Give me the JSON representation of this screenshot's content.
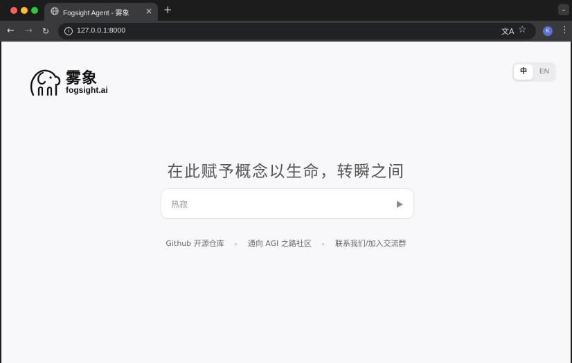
{
  "browser": {
    "tab_title": "Fogsight Agent - 雾象",
    "tab_close": "×",
    "new_tab": "+",
    "tab_menu": "⌄",
    "url": "127.0.0.1:8000",
    "profile_initial": "K",
    "nav": {
      "back": "←",
      "forward": "→",
      "reload": "↻",
      "more": "⋮"
    },
    "icons": {
      "site": "globe-icon",
      "info": "info-icon",
      "translate": "translate-icon",
      "bookmark": "star-icon"
    }
  },
  "logo": {
    "name_cn": "雾象",
    "name_en": "fogsight.ai",
    "icon": "elephant-icon"
  },
  "lang": {
    "zh": "中",
    "en": "EN",
    "active": "zh"
  },
  "hero": {
    "headline": "在此赋予概念以生命，转瞬之间"
  },
  "search": {
    "placeholder": "热寂",
    "value": "",
    "send_icon": "play-icon"
  },
  "links": [
    {
      "label": "Github 开源仓库"
    },
    {
      "label": "通向 AGI 之路社区"
    },
    {
      "label": "联系我们/加入交流群"
    }
  ],
  "colors": {
    "page_bg": "#f8f8fa",
    "chrome_dark": "#1c1c1d",
    "toolbar": "#3a3a3c",
    "profile": "#5b6fd6"
  }
}
